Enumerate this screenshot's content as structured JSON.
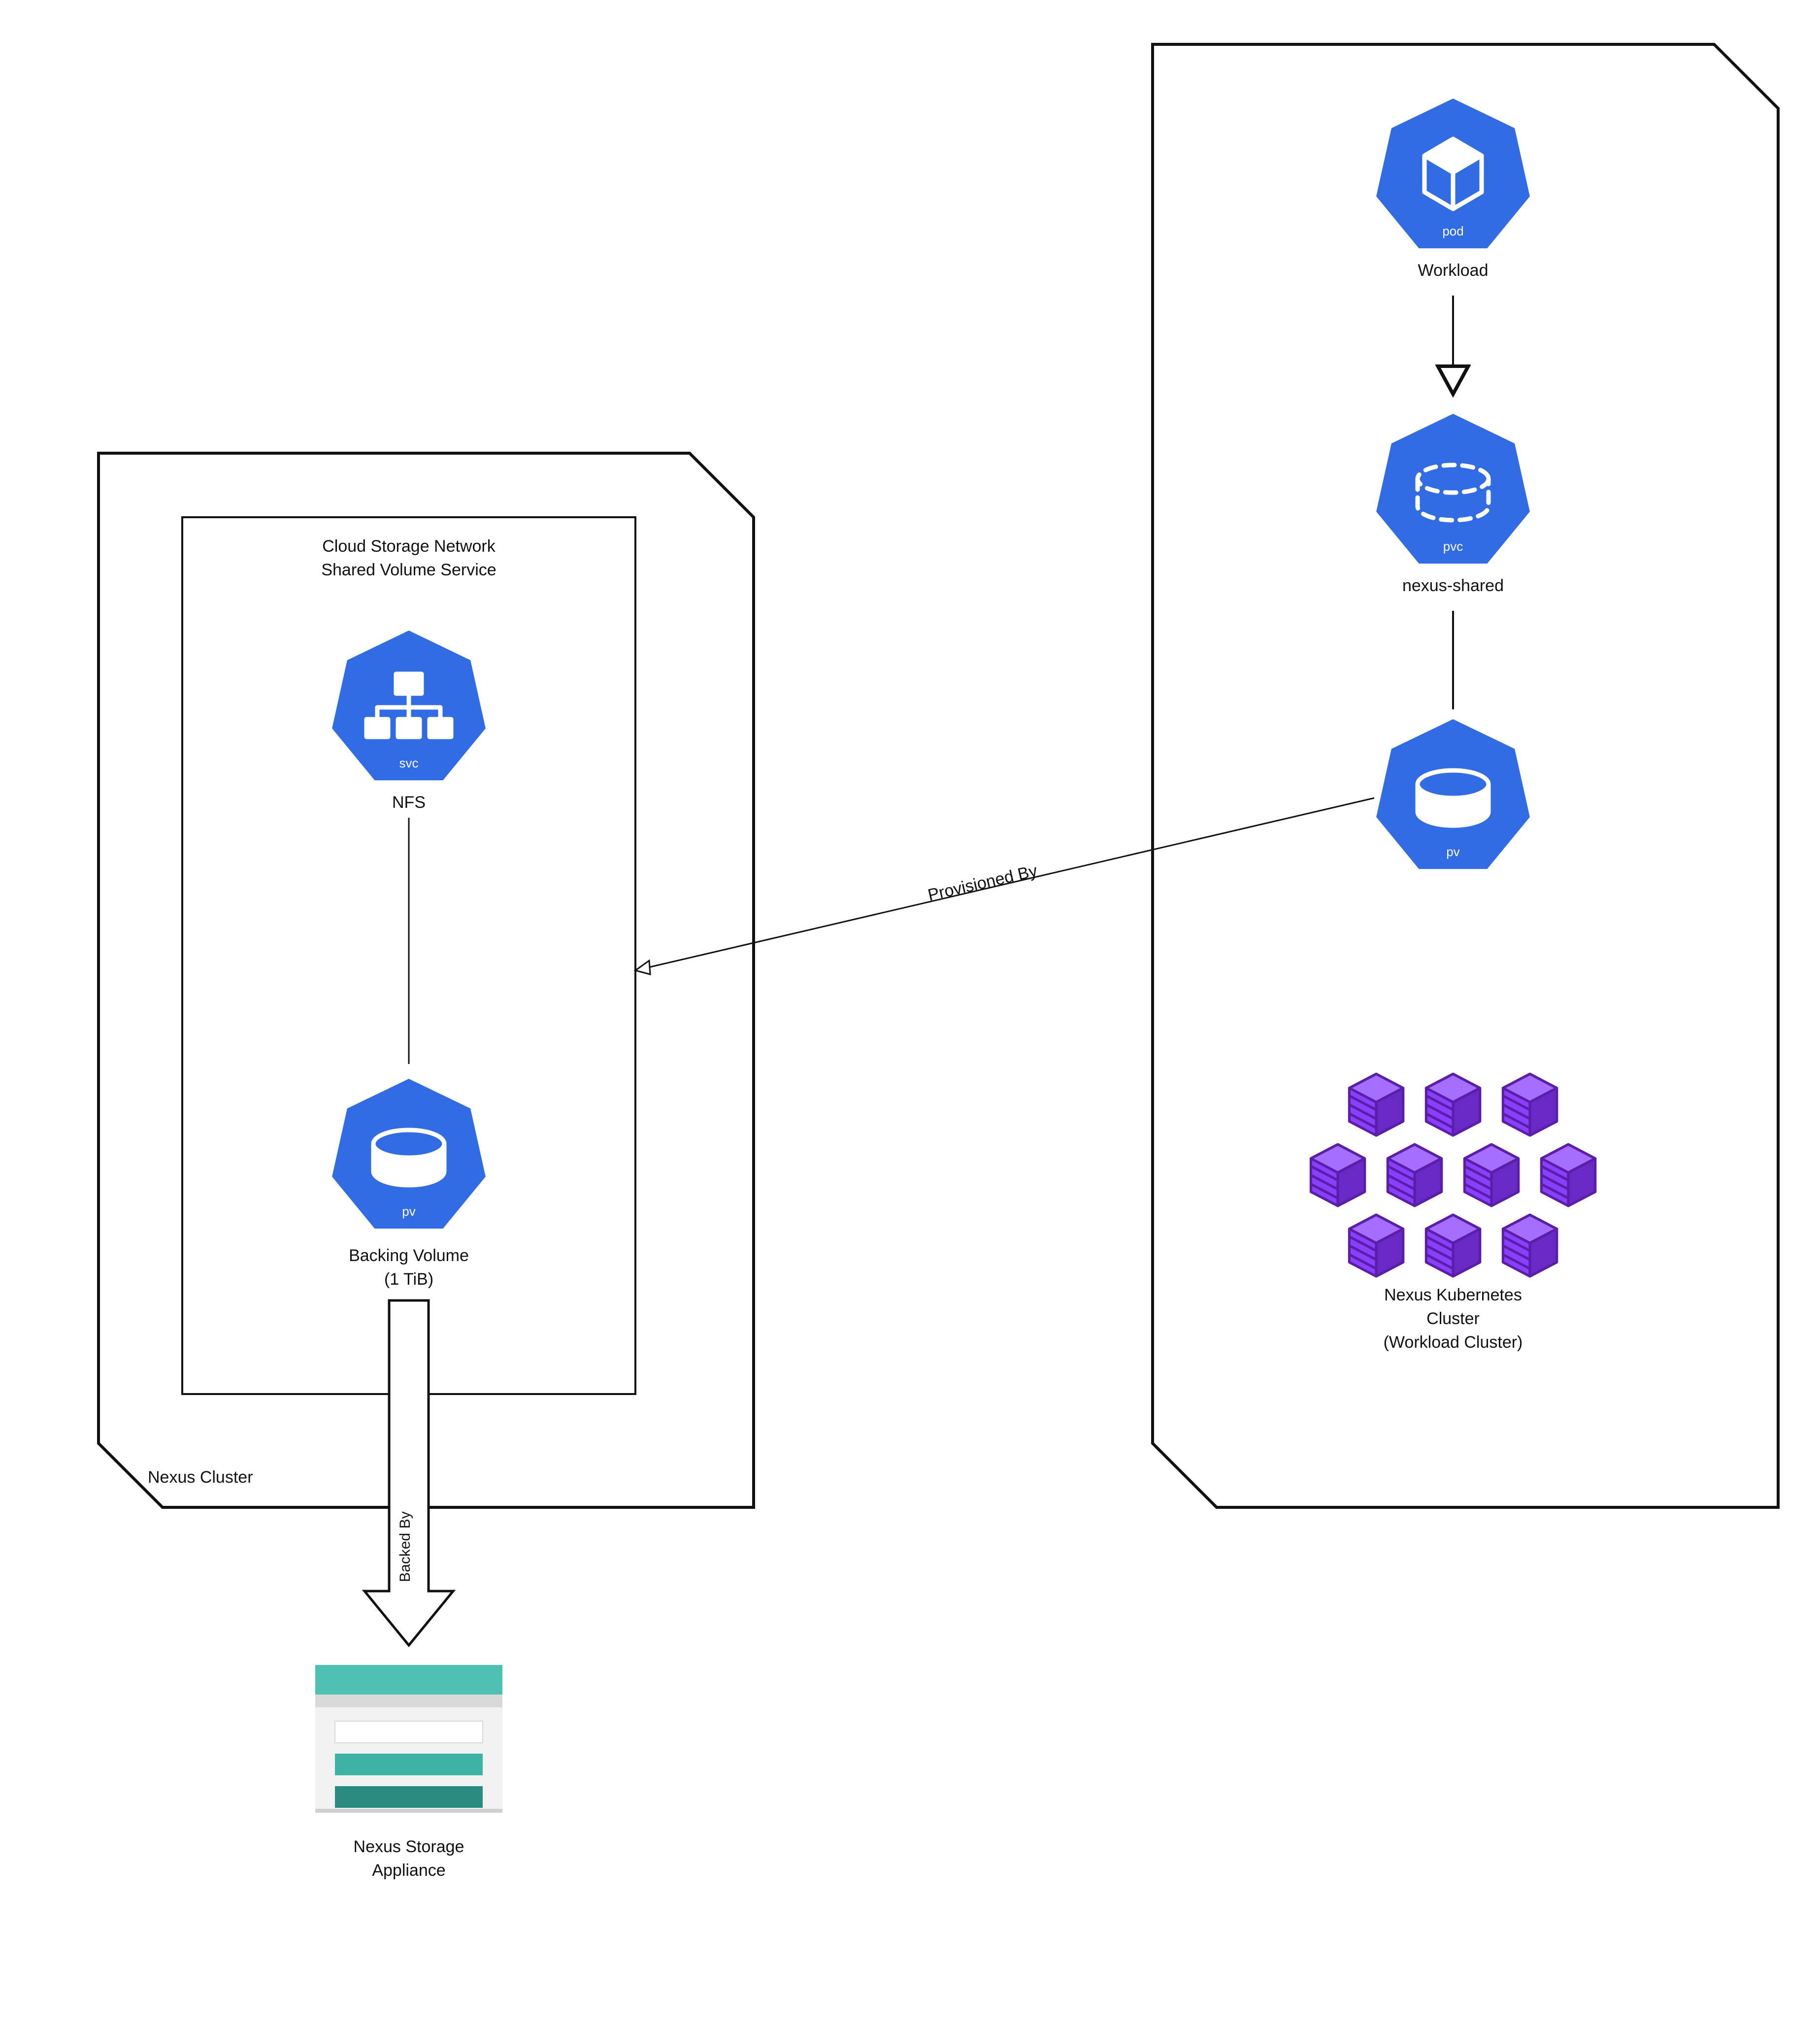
{
  "left": {
    "container_label": "Nexus Cluster",
    "inner_title_line1": "Cloud Storage Network",
    "inner_title_line2": "Shared Volume Service",
    "svc": {
      "tag": "svc",
      "caption": "NFS"
    },
    "pv": {
      "tag": "pv",
      "caption_line1": "Backing Volume",
      "caption_line2": "(1 TiB)"
    },
    "backed_by": "Backed By",
    "storage": {
      "caption_line1": "Nexus Storage",
      "caption_line2": "Appliance"
    }
  },
  "right": {
    "pod": {
      "tag": "pod",
      "caption": "Workload"
    },
    "pvc": {
      "tag": "pvc",
      "caption": "nexus-shared"
    },
    "pv": {
      "tag": "pv"
    },
    "cluster_caption_line1": "Nexus Kubernetes",
    "cluster_caption_line2": "Cluster",
    "cluster_caption_line3": "(Workload Cluster)"
  },
  "link": {
    "provisioned_by": "Provisioned By"
  },
  "colors": {
    "k8s_blue": "#326ce5",
    "purple": "#8a3ffc",
    "purple_dark": "#6929c4",
    "teal": "#4ec1b4",
    "teal_mid": "#3db3a4",
    "teal_dark": "#2a8c80",
    "grey_light": "#f0f0f0",
    "grey": "#d9d9d9"
  }
}
